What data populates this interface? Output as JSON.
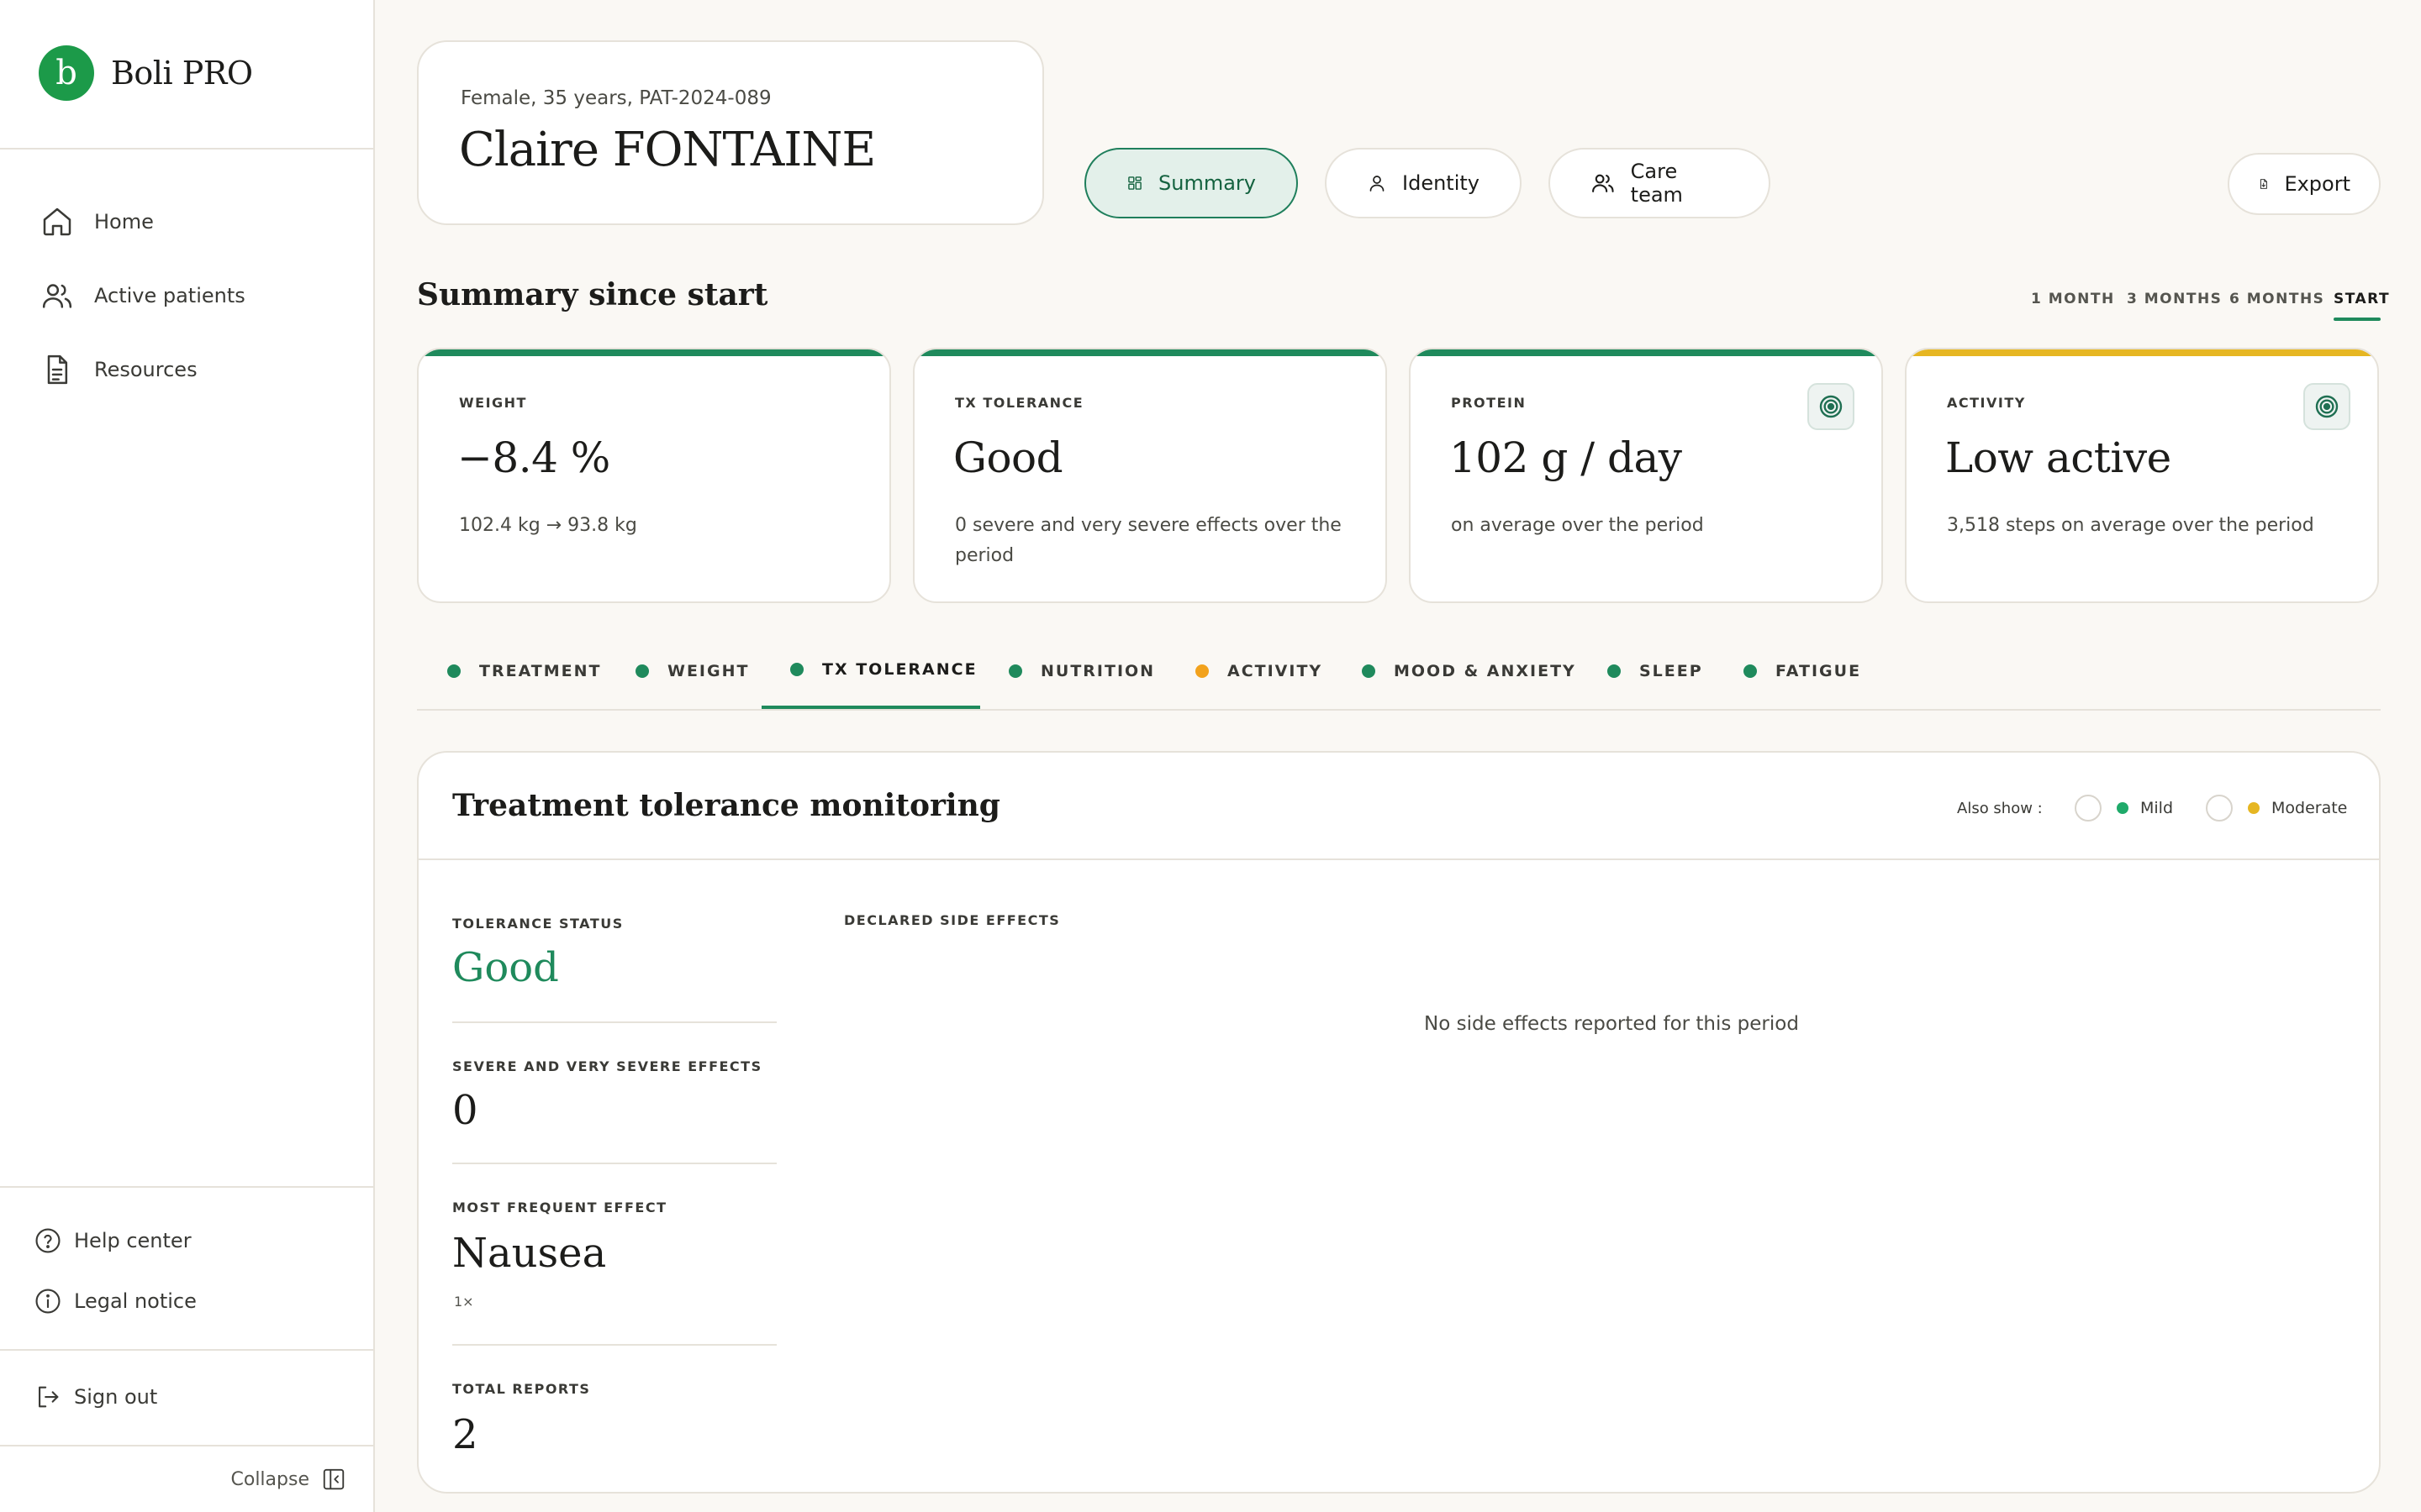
{
  "brand": {
    "logo_letter": "b",
    "name": "Boli PRO"
  },
  "sidebar": {
    "nav": [
      {
        "label": "Home",
        "icon": "home-icon"
      },
      {
        "label": "Active patients",
        "icon": "users-icon"
      },
      {
        "label": "Resources",
        "icon": "document-icon"
      }
    ],
    "footer": [
      {
        "label": "Help center",
        "icon": "help-icon"
      },
      {
        "label": "Legal notice",
        "icon": "info-icon"
      }
    ],
    "sign_out": "Sign out",
    "collapse": "Collapse"
  },
  "patient": {
    "meta": "Female, 35 years, PAT-2024-089",
    "name": "Claire FONTAINE"
  },
  "header_tabs": {
    "summary": "Summary",
    "identity": "Identity",
    "care_team": "Care team",
    "export": "Export"
  },
  "summary": {
    "title": "Summary since start",
    "ranges": [
      "1 MONTH",
      "3 MONTHS",
      "6 MONTHS",
      "START"
    ],
    "active_range": "START"
  },
  "kpis": [
    {
      "label": "WEIGHT",
      "value": "−8.4 %",
      "sub": "102.4 kg → 93.8 kg",
      "status": "green"
    },
    {
      "label": "TX TOLERANCE",
      "value": "Good",
      "sub": "0 severe and very severe effects over the period",
      "status": "green"
    },
    {
      "label": "PROTEIN",
      "value": "102 g / day",
      "sub": "on average over the period",
      "status": "green",
      "icon": "target-icon"
    },
    {
      "label": "ACTIVITY",
      "value": "Low active",
      "sub": "3,518 steps on average over the period",
      "status": "yellow",
      "icon": "target-icon"
    }
  ],
  "section_tabs": [
    {
      "label": "TREATMENT",
      "dot": "green"
    },
    {
      "label": "WEIGHT",
      "dot": "green"
    },
    {
      "label": "TX TOLERANCE",
      "dot": "green",
      "active": true
    },
    {
      "label": "NUTRITION",
      "dot": "green"
    },
    {
      "label": "ACTIVITY",
      "dot": "orange"
    },
    {
      "label": "MOOD & ANXIETY",
      "dot": "green"
    },
    {
      "label": "SLEEP",
      "dot": "green"
    },
    {
      "label": "FATIGUE",
      "dot": "green"
    }
  ],
  "panel": {
    "title": "Treatment tolerance monitoring",
    "also_show": "Also show :",
    "filters": [
      {
        "label": "Mild",
        "color": "#1faa6a"
      },
      {
        "label": "Moderate",
        "color": "#e6b622"
      }
    ],
    "stats": {
      "tolerance_status_label": "TOLERANCE STATUS",
      "tolerance_status_value": "Good",
      "severe_label": "SEVERE AND VERY SEVERE EFFECTS",
      "severe_value": "0",
      "frequent_label": "MOST FREQUENT EFFECT",
      "frequent_value": "Nausea",
      "frequent_count": "1×",
      "total_label": "TOTAL REPORTS",
      "total_value": "2"
    },
    "declared_label": "DECLARED SIDE EFFECTS",
    "empty_message": "No side effects reported for this period"
  },
  "colors": {
    "accent": "#1f8a5c",
    "brand": "#1c9a49",
    "warning": "#e6b622",
    "orange": "#f2a21c"
  }
}
